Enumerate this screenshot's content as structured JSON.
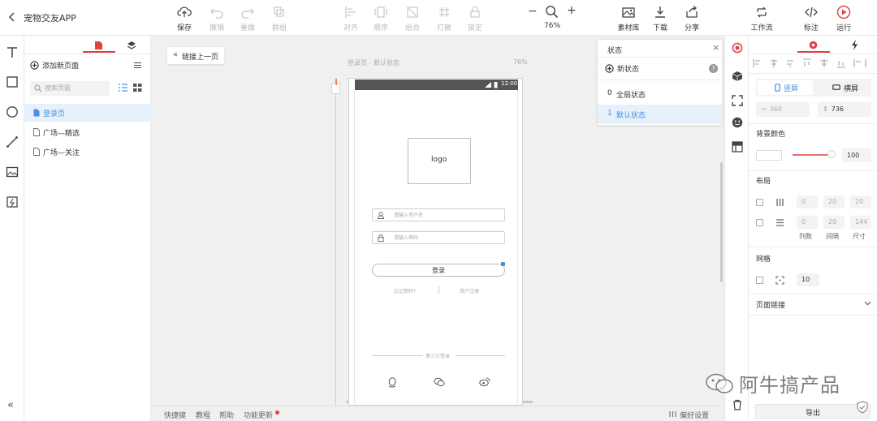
{
  "app": {
    "title": "宠物交友APP"
  },
  "toolbar": {
    "save": "保存",
    "undo": "撤销",
    "redo": "重做",
    "group": "群组",
    "align": "对齐",
    "distribute": "顺序",
    "combine": "组合",
    "lock": "打散",
    "lock2": "锁定",
    "zoom": "76%",
    "assets": "素材库",
    "download": "下载",
    "share": "分享",
    "workflow": "工作流",
    "annotate": "标注",
    "run": "运行"
  },
  "pages": {
    "add_page": "添加新页面",
    "search_placeholder": "搜索页面",
    "items": [
      "登录页",
      "广场—精选",
      "广场—关注"
    ]
  },
  "canvas": {
    "link_prev": "链接上一页",
    "page_caption": "登录页 - 默认状态",
    "zoom_caption": "76%"
  },
  "phone": {
    "time": "12:00",
    "logo": "logo",
    "username_placeholder": "请输入用户名",
    "password_placeholder": "请输入密码",
    "login_button": "登录",
    "forgot": "忘记密码?",
    "register": "用户注册",
    "third_party": "第三方登录"
  },
  "states": {
    "title": "状态",
    "new_state": "新状态",
    "items": [
      {
        "index": "0",
        "label": "全局状态"
      },
      {
        "index": "1",
        "label": "默认状态"
      }
    ]
  },
  "bottom": {
    "shortcuts": "快捷键",
    "tutorial": "教程",
    "help": "帮助",
    "updates": "功能更新",
    "preferences": "偏好设置"
  },
  "props": {
    "portrait": "竖屏",
    "landscape": "横屏",
    "width": "360",
    "height": "736",
    "bg_color_title": "背景颜色",
    "opacity": "100",
    "layout_title": "布局",
    "layout_row1": [
      "0",
      "20",
      "20"
    ],
    "layout_row2": [
      "0",
      "20",
      "144"
    ],
    "col_count": "列数",
    "gap": "间隔",
    "size": "尺寸",
    "grid_title": "网格",
    "grid_value": "10",
    "page_link_title": "页面链接",
    "export": "导出"
  },
  "watermark": "阿牛搞产品",
  "colors": {
    "accent": "#4a90e2",
    "red": "#e23f3f",
    "selected_bg": "#e6f1fc"
  }
}
